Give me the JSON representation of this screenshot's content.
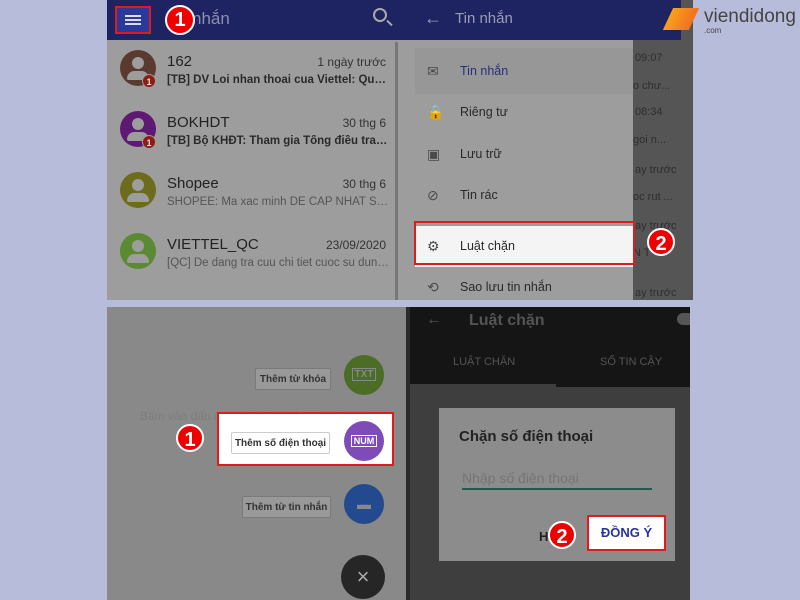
{
  "brand": {
    "name": "viendidong",
    "sub": ".com"
  },
  "panel1": {
    "title": "nhắn",
    "step": "1",
    "conversations": [
      {
        "name": "162",
        "time": "1 ngày trước",
        "preview": "[TB] DV Loi nhan thoai cua Viettel: Quy kh...",
        "unread": "1",
        "color": "#5a3a2e",
        "bold": true
      },
      {
        "name": "BOKHDT",
        "time": "30 thg 6",
        "preview": "[TB] Bộ KHĐT: Tham gia Tổng điều tra kin...",
        "unread": "1",
        "color": "#5e1a73",
        "bold": true
      },
      {
        "name": "Shopee",
        "time": "30 thg 6",
        "preview": "SHOPEE: Ma xac minh DE CAP NHAT SO ...",
        "color": "#6d6b1c",
        "bold": false
      },
      {
        "name": "VIETTEL_QC",
        "time": "23/09/2020",
        "preview": "[QC] De dang tra cuu chi tiet cuoc su dung ...",
        "color": "#5a8a32",
        "bold": false
      }
    ]
  },
  "panel2": {
    "title": "Tin nhắn",
    "step": "2",
    "menu": [
      {
        "label": "Tin nhắn",
        "icon": "mail-icon",
        "glyph": "✉"
      },
      {
        "label": "Riêng tư",
        "icon": "lock-icon",
        "glyph": "🔒"
      },
      {
        "label": "Lưu trữ",
        "icon": "archive-icon",
        "glyph": "▣"
      },
      {
        "label": "Tin rác",
        "icon": "block-icon",
        "glyph": "⊘"
      },
      {
        "label": "Luật chặn",
        "icon": "gear-icon",
        "glyph": "⚙"
      },
      {
        "label": "Sao lưu tin nhắn",
        "icon": "backup-icon",
        "glyph": "⟲"
      }
    ],
    "behind": [
      "09:07",
      "o chư...",
      "08:34",
      "goi n...",
      "ay trước",
      "oc rut ...",
      "ay trước",
      "N T",
      "ay trước"
    ]
  },
  "panel3": {
    "hint": "Bấm vào dấu (+) bên dưới để tạo luật chặn.",
    "step": "1",
    "add_keyword": "Thêm từ khóa",
    "txt": "TXT",
    "add_phone": "Thêm số điện thoại",
    "num": "NUM",
    "add_message": "Thêm từ tin nhắn",
    "close": "×"
  },
  "panel4": {
    "title": "Luật chặn",
    "tabs": [
      "LUẬT CHẶN",
      "SỐ TIN CẬY"
    ],
    "dialog": {
      "title": "Chặn số điện thoại",
      "placeholder": "Nhập số điện thoại",
      "cancel": "H",
      "ok": "ĐỒNG Ý"
    },
    "step": "2"
  }
}
